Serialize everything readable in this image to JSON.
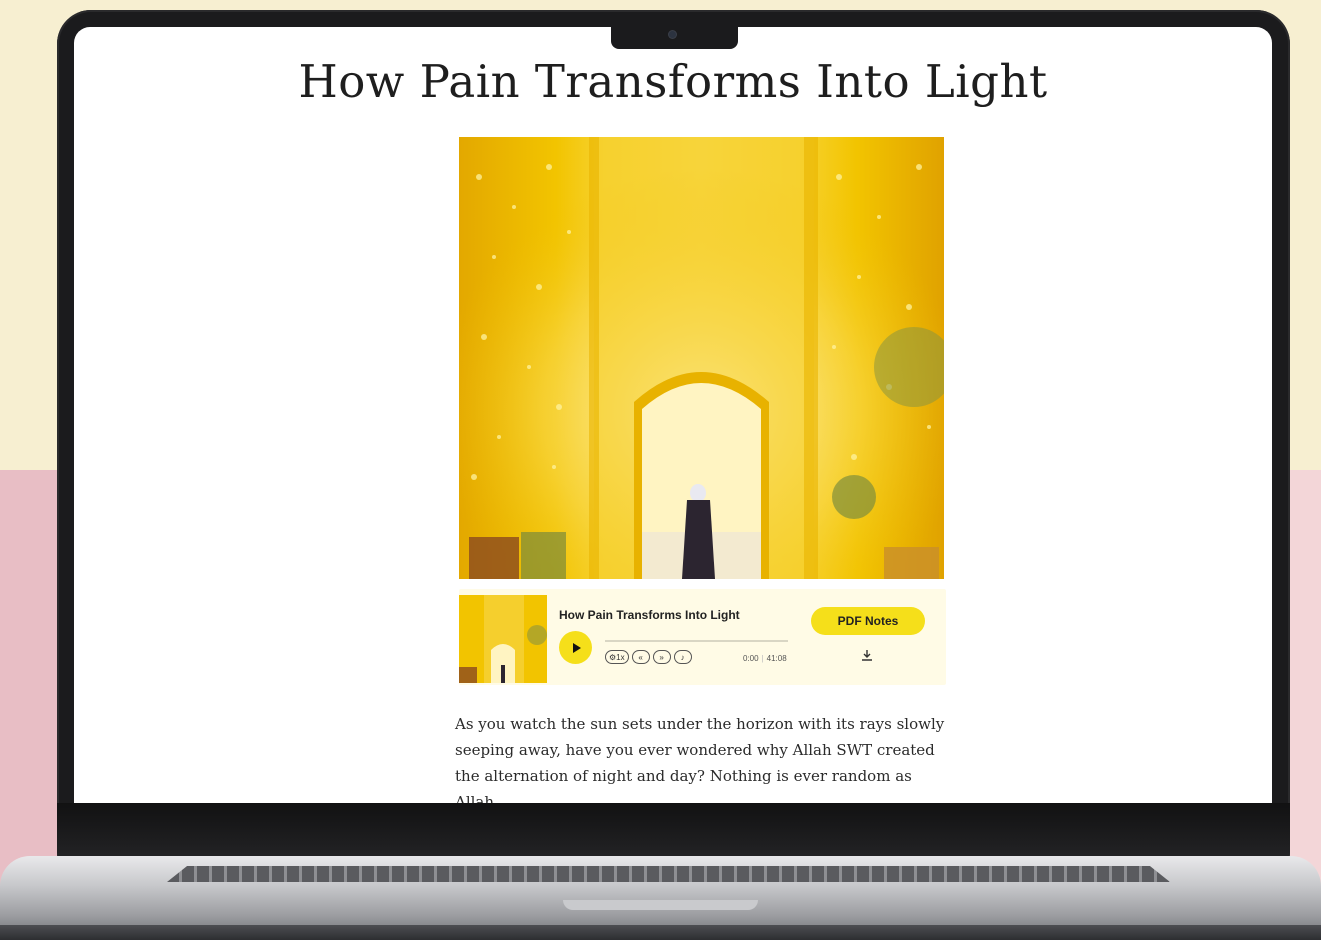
{
  "article": {
    "title": "How Pain Transforms Into Light",
    "body_excerpt": "As you watch the sun sets under the horizon with its rays slowly seeping away, have you ever wondered why Allah SWT created the alternation of night and day? Nothing is ever random as Allah"
  },
  "player": {
    "track_title": "How Pain Transforms Into Light",
    "speed_label": "1x",
    "current_time": "0:00",
    "duration": "41:08",
    "progress": 0,
    "pdf_button_label": "PDF Notes"
  },
  "colors": {
    "accent_yellow": "#f5df1a",
    "player_background": "#fffbe6",
    "hero_gold": "#f2c400"
  },
  "icons": {
    "play": "play-icon",
    "rewind": "rewind-icon",
    "forward": "forward-icon",
    "volume": "volume-icon",
    "download": "download-icon"
  }
}
